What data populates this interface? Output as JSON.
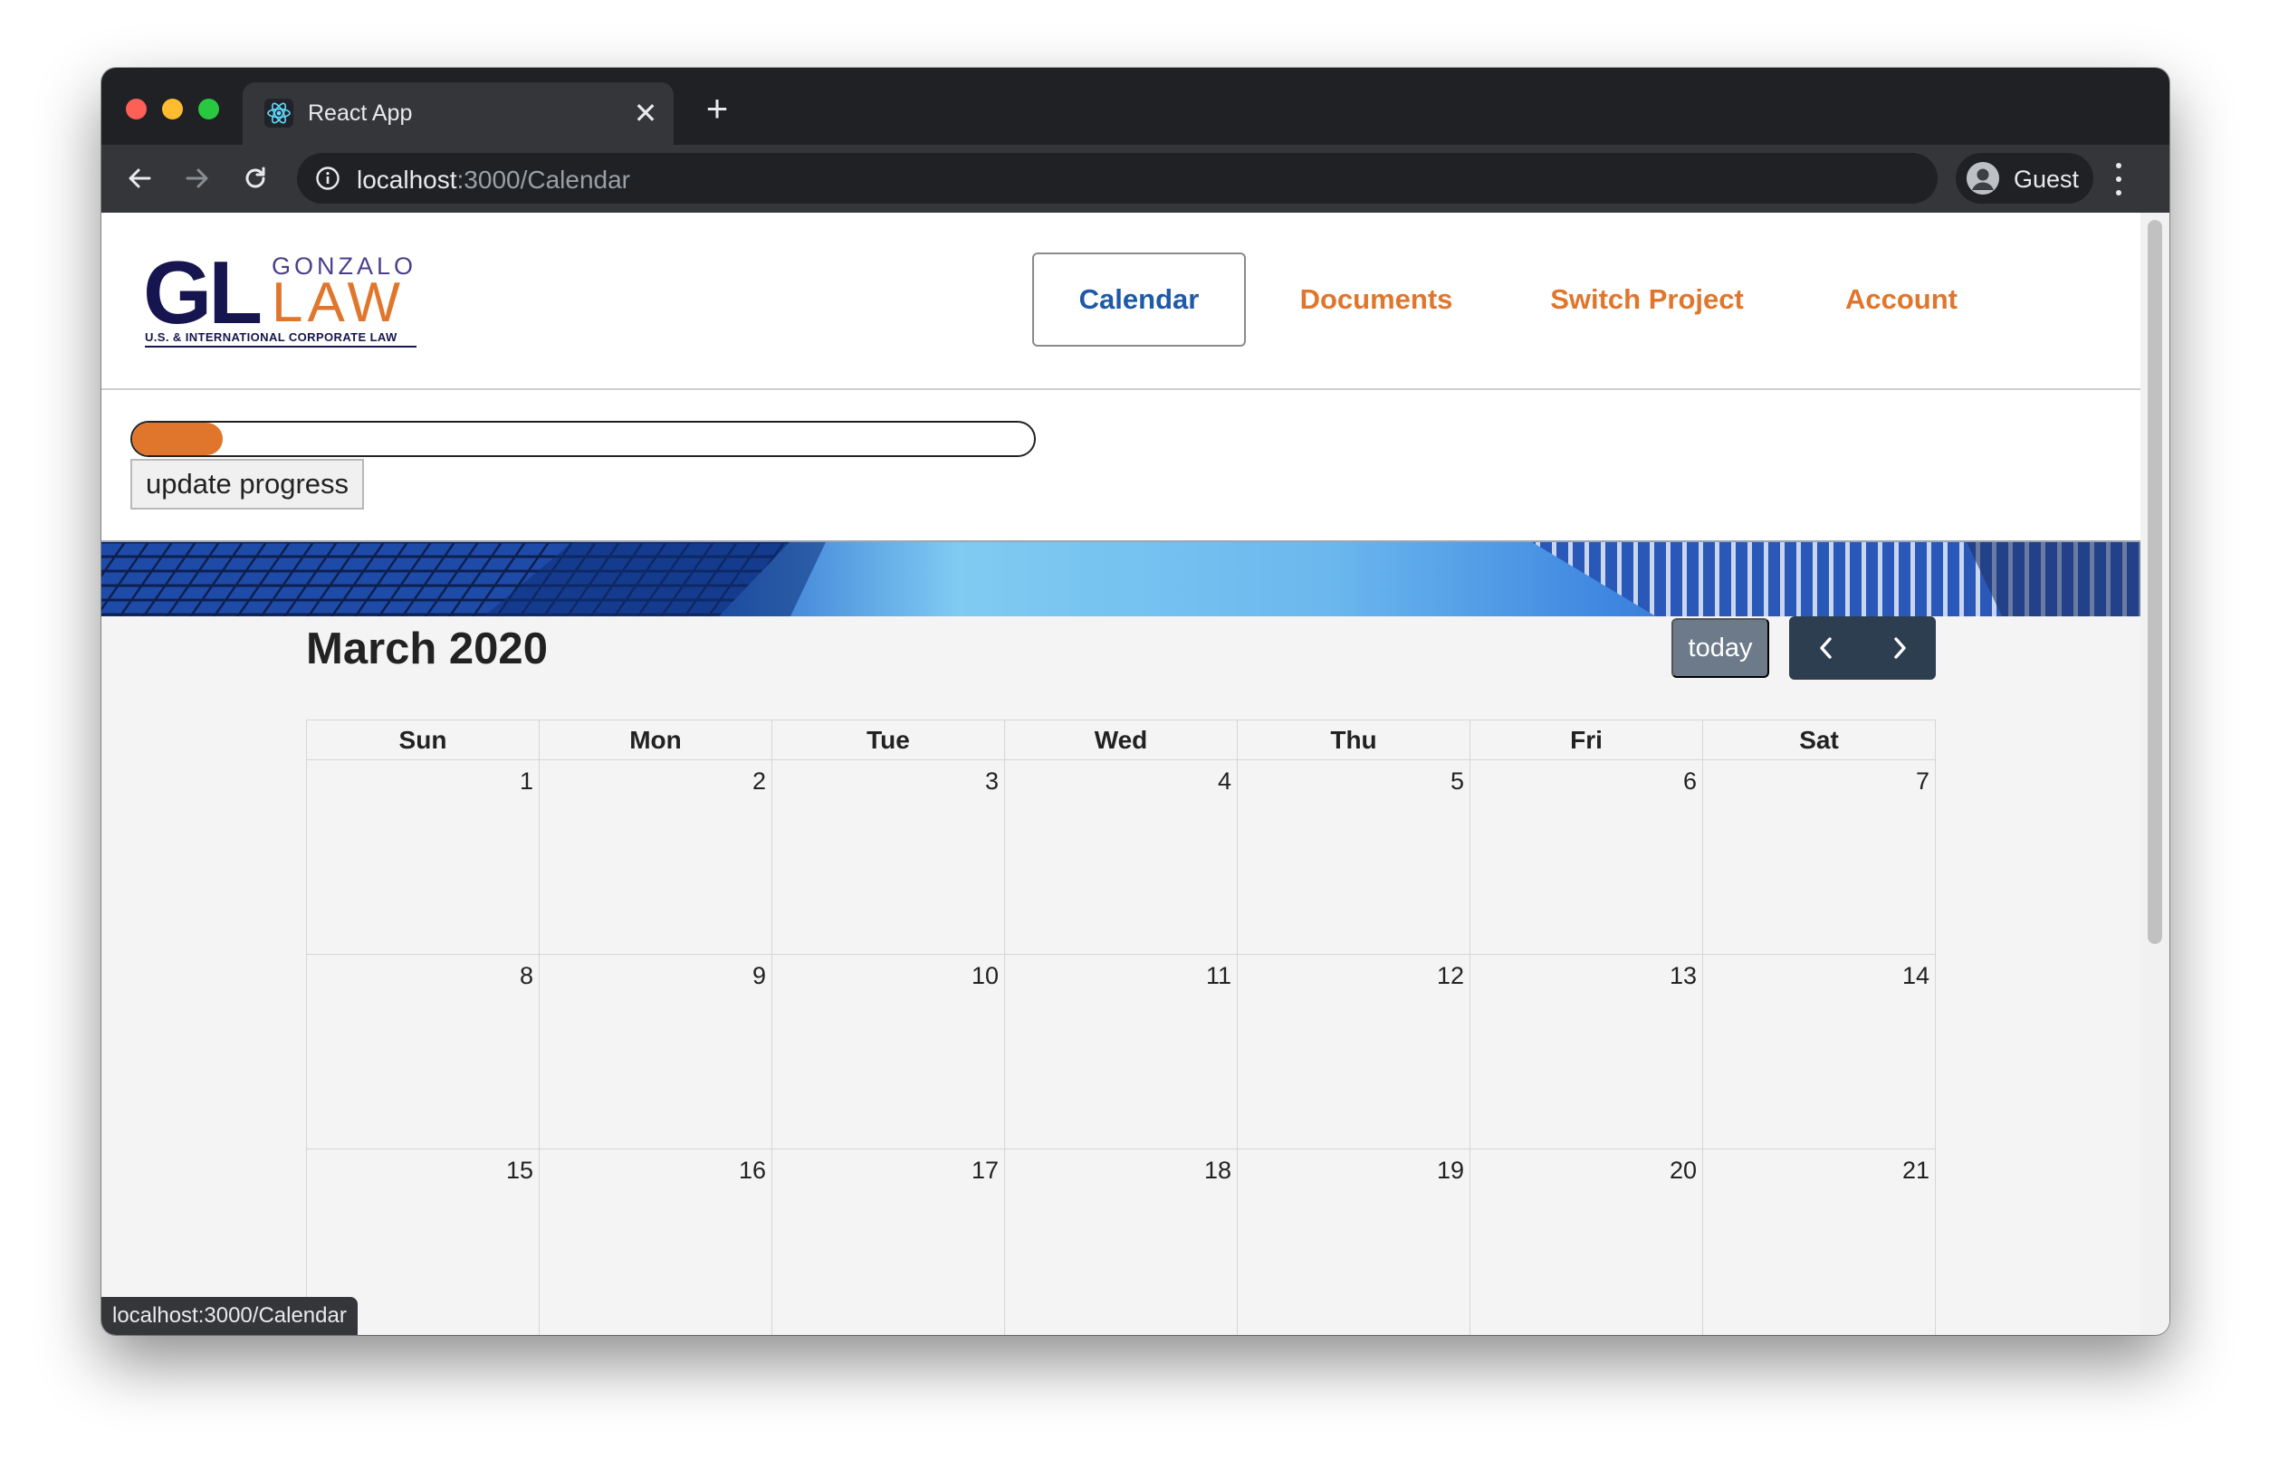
{
  "browser": {
    "tab": {
      "title": "React App",
      "favicon": "react-atom-icon"
    },
    "address": {
      "host": "localhost",
      "path": ":3000/Calendar"
    },
    "profile": {
      "name": "Guest"
    },
    "status_url": "localhost:3000/Calendar"
  },
  "site": {
    "logo": {
      "mark": "GL",
      "top_word": "GONZALO",
      "bottom_word": "LAW",
      "tagline": "U.S. & INTERNATIONAL CORPORATE LAW"
    },
    "nav": [
      {
        "label": "Calendar",
        "active": true
      },
      {
        "label": "Documents",
        "active": false
      },
      {
        "label": "Switch Project",
        "active": false
      },
      {
        "label": "Account",
        "active": false
      }
    ]
  },
  "progress": {
    "value_percent": 10,
    "button_label": "update progress"
  },
  "calendar": {
    "title": "March 2020",
    "today_label": "today",
    "weekdays": [
      "Sun",
      "Mon",
      "Tue",
      "Wed",
      "Thu",
      "Fri",
      "Sat"
    ],
    "weeks": [
      [
        "1",
        "2",
        "3",
        "4",
        "5",
        "6",
        "7"
      ],
      [
        "8",
        "9",
        "10",
        "11",
        "12",
        "13",
        "14"
      ],
      [
        "15",
        "16",
        "17",
        "18",
        "19",
        "20",
        "21"
      ]
    ]
  },
  "colors": {
    "accent_orange": "#e0762c",
    "nav_active_blue": "#1d5aa7",
    "logo_navy": "#16154f",
    "toolbar_dark": "#2c3e50",
    "today_gray": "#6c7a89"
  }
}
